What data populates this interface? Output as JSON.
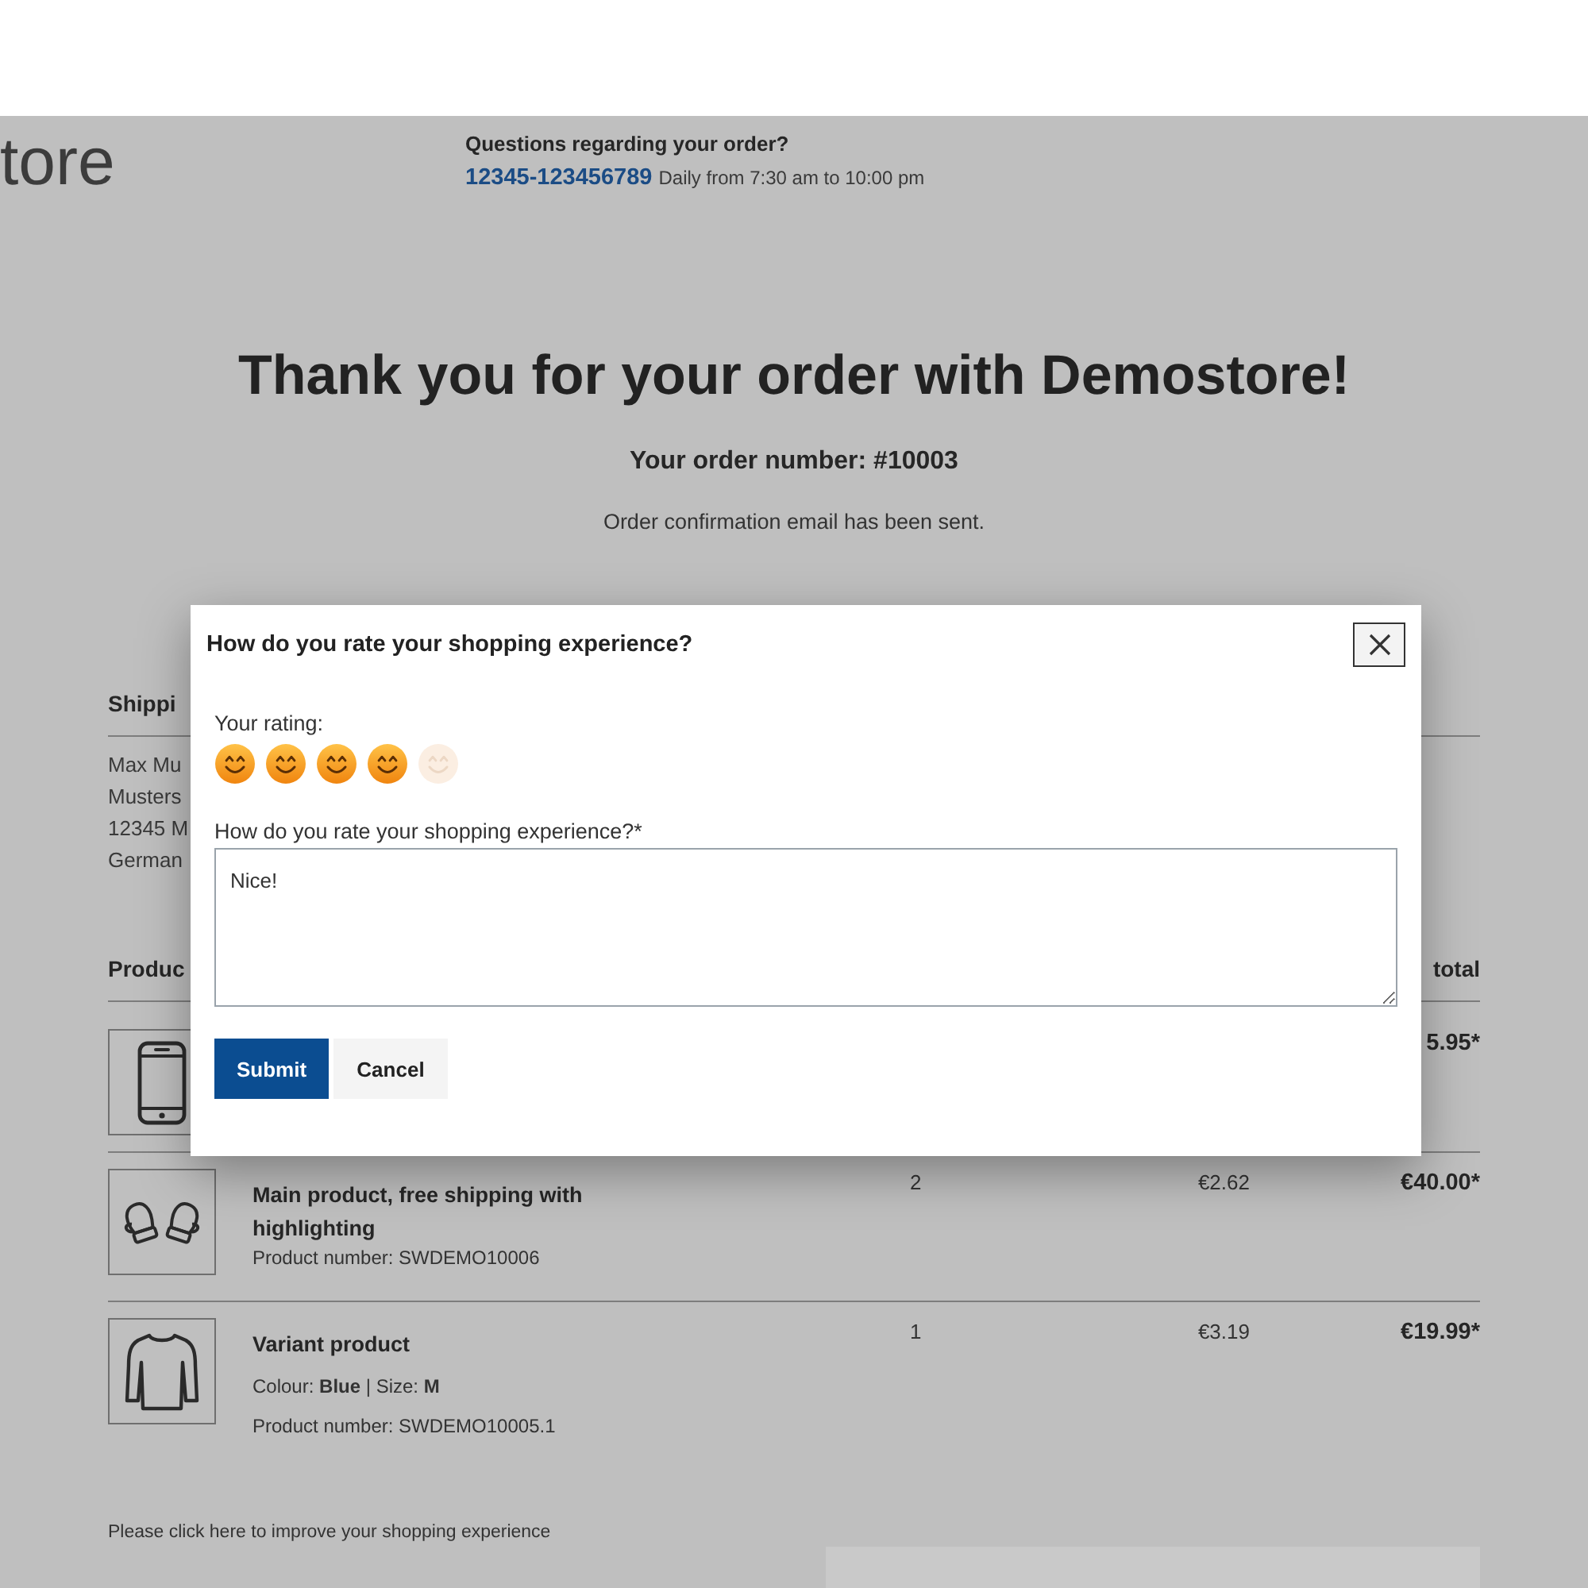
{
  "header": {
    "logo": "tore",
    "help_title": "Questions regarding your order?",
    "phone": "12345-123456789",
    "hours": "Daily from 7:30 am to 10:00 pm"
  },
  "confirmation": {
    "title": "Thank you for your order with Demostore!",
    "order_number": "Your order number: #10003",
    "email_note": "Order confirmation email has been sent."
  },
  "shipping": {
    "heading": "Shippi",
    "address_lines": [
      "Max Mu",
      "Musters",
      "12345 M",
      "German"
    ]
  },
  "products": {
    "columns": [
      {
        "label": "Produc"
      },
      {
        "label": "total"
      }
    ],
    "rows": [
      {
        "subtotal": "5.95*"
      },
      {
        "name": "Main product, free shipping with highlighting",
        "product_number": "Product number: SWDEMO10006",
        "quantity": "2",
        "unit_price": "€2.62",
        "subtotal": "€40.00*"
      },
      {
        "name": "Variant product",
        "details": "Colour: **Blue** | Size: **M**",
        "product_number": "Product number: SWDEMO10005.1",
        "quantity": "1",
        "unit_price": "€3.19",
        "subtotal": "€19.99*"
      }
    ]
  },
  "feedback_link": "Please click here to improve your shopping experience",
  "rating_dialog": {
    "title": "How do you rate your shopping experience?",
    "rating_label": "Your rating:",
    "rating": {
      "stars": 4
    },
    "comment_label": "How do you rate your shopping experience?*",
    "comment": {
      "value": "Nice!"
    },
    "buttons": [
      {
        "label": "Submit",
        "kind": "primary"
      },
      {
        "label": "Cancel",
        "kind": "secondary"
      }
    ]
  }
}
